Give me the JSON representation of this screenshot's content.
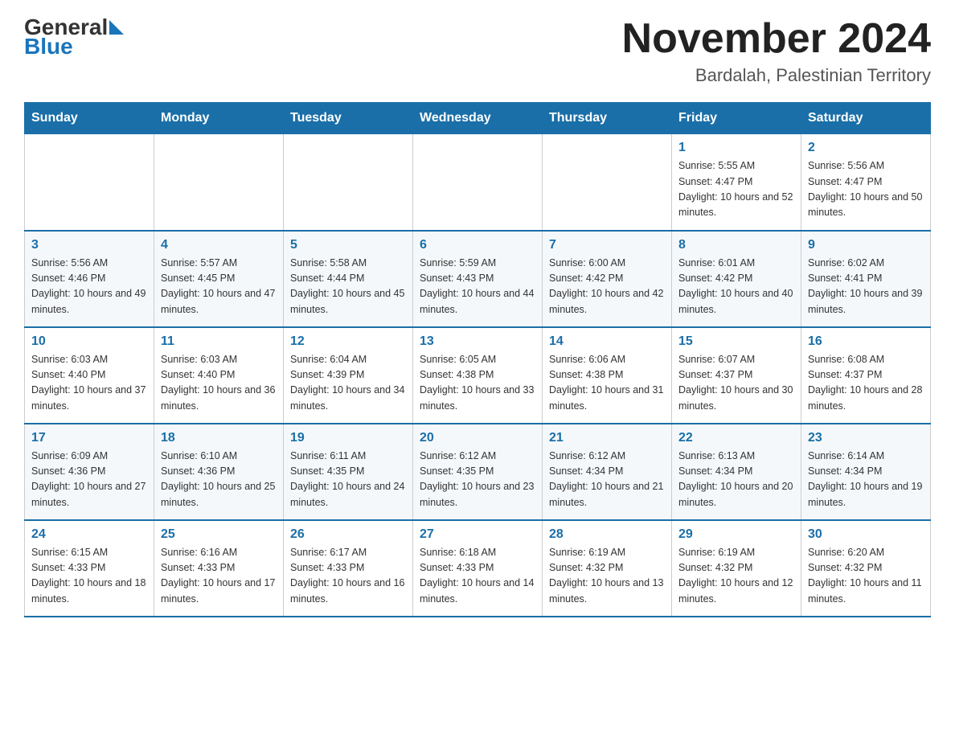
{
  "header": {
    "logo_general": "General",
    "logo_blue": "Blue",
    "title": "November 2024",
    "subtitle": "Bardalah, Palestinian Territory"
  },
  "days_of_week": [
    "Sunday",
    "Monday",
    "Tuesday",
    "Wednesday",
    "Thursday",
    "Friday",
    "Saturday"
  ],
  "weeks": [
    {
      "days": [
        {
          "num": "",
          "info": ""
        },
        {
          "num": "",
          "info": ""
        },
        {
          "num": "",
          "info": ""
        },
        {
          "num": "",
          "info": ""
        },
        {
          "num": "",
          "info": ""
        },
        {
          "num": "1",
          "info": "Sunrise: 5:55 AM\nSunset: 4:47 PM\nDaylight: 10 hours and 52 minutes."
        },
        {
          "num": "2",
          "info": "Sunrise: 5:56 AM\nSunset: 4:47 PM\nDaylight: 10 hours and 50 minutes."
        }
      ]
    },
    {
      "days": [
        {
          "num": "3",
          "info": "Sunrise: 5:56 AM\nSunset: 4:46 PM\nDaylight: 10 hours and 49 minutes."
        },
        {
          "num": "4",
          "info": "Sunrise: 5:57 AM\nSunset: 4:45 PM\nDaylight: 10 hours and 47 minutes."
        },
        {
          "num": "5",
          "info": "Sunrise: 5:58 AM\nSunset: 4:44 PM\nDaylight: 10 hours and 45 minutes."
        },
        {
          "num": "6",
          "info": "Sunrise: 5:59 AM\nSunset: 4:43 PM\nDaylight: 10 hours and 44 minutes."
        },
        {
          "num": "7",
          "info": "Sunrise: 6:00 AM\nSunset: 4:42 PM\nDaylight: 10 hours and 42 minutes."
        },
        {
          "num": "8",
          "info": "Sunrise: 6:01 AM\nSunset: 4:42 PM\nDaylight: 10 hours and 40 minutes."
        },
        {
          "num": "9",
          "info": "Sunrise: 6:02 AM\nSunset: 4:41 PM\nDaylight: 10 hours and 39 minutes."
        }
      ]
    },
    {
      "days": [
        {
          "num": "10",
          "info": "Sunrise: 6:03 AM\nSunset: 4:40 PM\nDaylight: 10 hours and 37 minutes."
        },
        {
          "num": "11",
          "info": "Sunrise: 6:03 AM\nSunset: 4:40 PM\nDaylight: 10 hours and 36 minutes."
        },
        {
          "num": "12",
          "info": "Sunrise: 6:04 AM\nSunset: 4:39 PM\nDaylight: 10 hours and 34 minutes."
        },
        {
          "num": "13",
          "info": "Sunrise: 6:05 AM\nSunset: 4:38 PM\nDaylight: 10 hours and 33 minutes."
        },
        {
          "num": "14",
          "info": "Sunrise: 6:06 AM\nSunset: 4:38 PM\nDaylight: 10 hours and 31 minutes."
        },
        {
          "num": "15",
          "info": "Sunrise: 6:07 AM\nSunset: 4:37 PM\nDaylight: 10 hours and 30 minutes."
        },
        {
          "num": "16",
          "info": "Sunrise: 6:08 AM\nSunset: 4:37 PM\nDaylight: 10 hours and 28 minutes."
        }
      ]
    },
    {
      "days": [
        {
          "num": "17",
          "info": "Sunrise: 6:09 AM\nSunset: 4:36 PM\nDaylight: 10 hours and 27 minutes."
        },
        {
          "num": "18",
          "info": "Sunrise: 6:10 AM\nSunset: 4:36 PM\nDaylight: 10 hours and 25 minutes."
        },
        {
          "num": "19",
          "info": "Sunrise: 6:11 AM\nSunset: 4:35 PM\nDaylight: 10 hours and 24 minutes."
        },
        {
          "num": "20",
          "info": "Sunrise: 6:12 AM\nSunset: 4:35 PM\nDaylight: 10 hours and 23 minutes."
        },
        {
          "num": "21",
          "info": "Sunrise: 6:12 AM\nSunset: 4:34 PM\nDaylight: 10 hours and 21 minutes."
        },
        {
          "num": "22",
          "info": "Sunrise: 6:13 AM\nSunset: 4:34 PM\nDaylight: 10 hours and 20 minutes."
        },
        {
          "num": "23",
          "info": "Sunrise: 6:14 AM\nSunset: 4:34 PM\nDaylight: 10 hours and 19 minutes."
        }
      ]
    },
    {
      "days": [
        {
          "num": "24",
          "info": "Sunrise: 6:15 AM\nSunset: 4:33 PM\nDaylight: 10 hours and 18 minutes."
        },
        {
          "num": "25",
          "info": "Sunrise: 6:16 AM\nSunset: 4:33 PM\nDaylight: 10 hours and 17 minutes."
        },
        {
          "num": "26",
          "info": "Sunrise: 6:17 AM\nSunset: 4:33 PM\nDaylight: 10 hours and 16 minutes."
        },
        {
          "num": "27",
          "info": "Sunrise: 6:18 AM\nSunset: 4:33 PM\nDaylight: 10 hours and 14 minutes."
        },
        {
          "num": "28",
          "info": "Sunrise: 6:19 AM\nSunset: 4:32 PM\nDaylight: 10 hours and 13 minutes."
        },
        {
          "num": "29",
          "info": "Sunrise: 6:19 AM\nSunset: 4:32 PM\nDaylight: 10 hours and 12 minutes."
        },
        {
          "num": "30",
          "info": "Sunrise: 6:20 AM\nSunset: 4:32 PM\nDaylight: 10 hours and 11 minutes."
        }
      ]
    }
  ]
}
